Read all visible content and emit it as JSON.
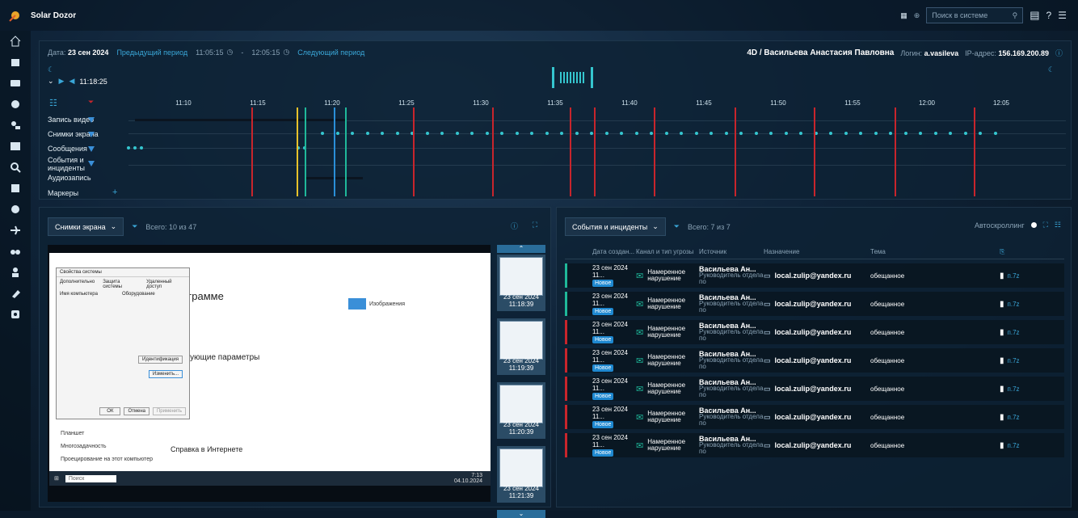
{
  "app": {
    "title": "Solar Dozor"
  },
  "topbar": {
    "search_placeholder": "Поиск в системе"
  },
  "timeline": {
    "date_label": "Дата:",
    "date_value": "23 сен 2024",
    "prev_link": "Предыдущий период",
    "time_from": "11:05:15",
    "time_to": "12:05:15",
    "next_link": "Следующий период",
    "current_time": "11:18:25",
    "user_name": "4D / Васильева Анастасия Павловна",
    "login_label": "Логин:",
    "login_value": "a.vasileva",
    "ip_label": "IP-адрес:",
    "ip_value": "156.169.200.89",
    "ticks": [
      "11:10",
      "11:15",
      "11:20",
      "11:25",
      "11:30",
      "11:35",
      "11:40",
      "11:45",
      "11:50",
      "11:55",
      "12:00",
      "12:05"
    ],
    "rows": {
      "video": "Запись видео",
      "screens": "Снимки экрана",
      "messages": "Сообщения",
      "events_line1": "События и",
      "events_line2": "инциденты",
      "audio": "Аудиозапись",
      "markers": "Маркеры"
    }
  },
  "screens_panel": {
    "dropdown": "Снимки экрана",
    "total": "Всего: 10 из 47",
    "thumbs": [
      "23 сен 2024 11:18:39",
      "23 сен 2024 11:19:39",
      "23 сен 2024 11:20:39",
      "23 сен 2024 11:21:39"
    ],
    "screenshot": {
      "dialog_title": "Свойства системы",
      "tabs": [
        "Дополнительно",
        "Защита системы",
        "Удаленный доступ"
      ],
      "tabs2": [
        "Имя компьютера",
        "Оборудование"
      ],
      "heading": "программе",
      "section": "утствующие параметры",
      "help": "Справка в Интернете",
      "taskbar_search": "Поиск",
      "sidebar_items": [
        "Планшет",
        "Многозадачность",
        "Проецирование на этот компьютер"
      ],
      "time": "7:13",
      "date": "04.10.2024",
      "btn_ok": "ОК",
      "btn_cancel": "Отмена",
      "btn_apply": "Применить",
      "btn_id": "Идентификация",
      "btn_change": "Изменить...",
      "images_label": "Изображения"
    }
  },
  "events_panel": {
    "dropdown": "События и инциденты",
    "total": "Всего: 7 из 7",
    "autoscroll": "Автоскроллинг",
    "columns": [
      "Дата создан...",
      "Канал и тип угрозы",
      "Источник",
      "Назначение",
      "Тема"
    ],
    "rows": [
      {
        "date": "23 сен 2024 11...",
        "status": "Новое",
        "channel": "Намеренное нарушение",
        "source_name": "Васильева Ан...",
        "source_role": "Руководитель отдела по",
        "dest": "local.zulip@yandex.ru",
        "topic": "обещанное",
        "file": "п.7z",
        "color": "#1fb89a"
      },
      {
        "date": "23 сен 2024 11...",
        "status": "Новое",
        "channel": "Намеренное нарушение",
        "source_name": "Васильева Ан...",
        "source_role": "Руководитель отдела по",
        "dest": "local.zulip@yandex.ru",
        "topic": "обещанное",
        "file": "п.7z",
        "color": "#1fb89a"
      },
      {
        "date": "23 сен 2024 11...",
        "status": "Новое",
        "channel": "Намеренное нарушение",
        "source_name": "Васильева Ан...",
        "source_role": "Руководитель отдела по",
        "dest": "local.zulip@yandex.ru",
        "topic": "обещанное",
        "file": "п.7z",
        "color": "#c8252c"
      },
      {
        "date": "23 сен 2024 11...",
        "status": "Новое",
        "channel": "Намеренное нарушение",
        "source_name": "Васильева Ан...",
        "source_role": "Руководитель отдела по",
        "dest": "local.zulip@yandex.ru",
        "topic": "обещанное",
        "file": "п.7z",
        "color": "#c8252c"
      },
      {
        "date": "23 сен 2024 11...",
        "status": "Новое",
        "channel": "Намеренное нарушение",
        "source_name": "Васильева Ан...",
        "source_role": "Руководитель отдела по",
        "dest": "local.zulip@yandex.ru",
        "topic": "обещанное",
        "file": "п.7z",
        "color": "#c8252c"
      },
      {
        "date": "23 сен 2024 11...",
        "status": "Новое",
        "channel": "Намеренное нарушение",
        "source_name": "Васильева Ан...",
        "source_role": "Руководитель отдела по",
        "dest": "local.zulip@yandex.ru",
        "topic": "обещанное",
        "file": "п.7z",
        "color": "#c8252c"
      },
      {
        "date": "23 сен 2024 11...",
        "status": "Новое",
        "channel": "Намеренное нарушение",
        "source_name": "Васильева Ан...",
        "source_role": "Руководитель отдела по",
        "dest": "local.zulip@yandex.ru",
        "topic": "обещанное",
        "file": "п.7z",
        "color": "#c8252c"
      }
    ]
  },
  "colors": {
    "accent": "#3aa7d8",
    "red": "#c8252c",
    "teal": "#1fb89a",
    "dot": "#35c6cf"
  }
}
